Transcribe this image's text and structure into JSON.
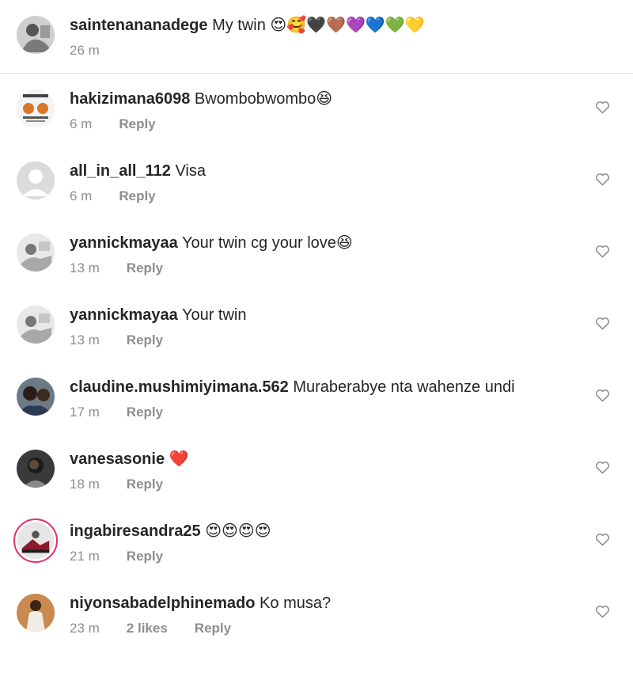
{
  "caption": {
    "username": "saintenananadege",
    "text": "My twin 😍🥰🖤🤎💜💙💚💛",
    "time": "26 m"
  },
  "comments": [
    {
      "username": "hakizimana6098",
      "text": "Bwombobwombo😆",
      "time": "6 m",
      "likes": "",
      "reply": "Reply"
    },
    {
      "username": "all_in_all_112",
      "text": "Visa",
      "time": "6 m",
      "likes": "",
      "reply": "Reply"
    },
    {
      "username": "yannickmayaa",
      "text": "Your twin cg your love😆",
      "time": "13 m",
      "likes": "",
      "reply": "Reply"
    },
    {
      "username": "yannickmayaa",
      "text": "Your twin",
      "time": "13 m",
      "likes": "",
      "reply": "Reply"
    },
    {
      "username": "claudine.mushimiyimana.562",
      "text": "Muraberabye nta wahenze undi",
      "time": "17 m",
      "likes": "",
      "reply": "Reply"
    },
    {
      "username": "vanesasonie",
      "text": "❤️",
      "time": "18 m",
      "likes": "",
      "reply": "Reply"
    },
    {
      "username": "ingabiresandra25",
      "text": "😍😍😍😍",
      "time": "21 m",
      "likes": "",
      "reply": "Reply"
    },
    {
      "username": "niyonsabadelphinemado",
      "text": "Ko musa?",
      "time": "23 m",
      "likes": "2 likes",
      "reply": "Reply"
    }
  ],
  "icons": {
    "like": "heart-outline-icon"
  },
  "colors": {
    "text": "#262626",
    "muted": "#8e8e8e",
    "story_ring": "#e1306c",
    "divider": "#dbdbdb"
  }
}
